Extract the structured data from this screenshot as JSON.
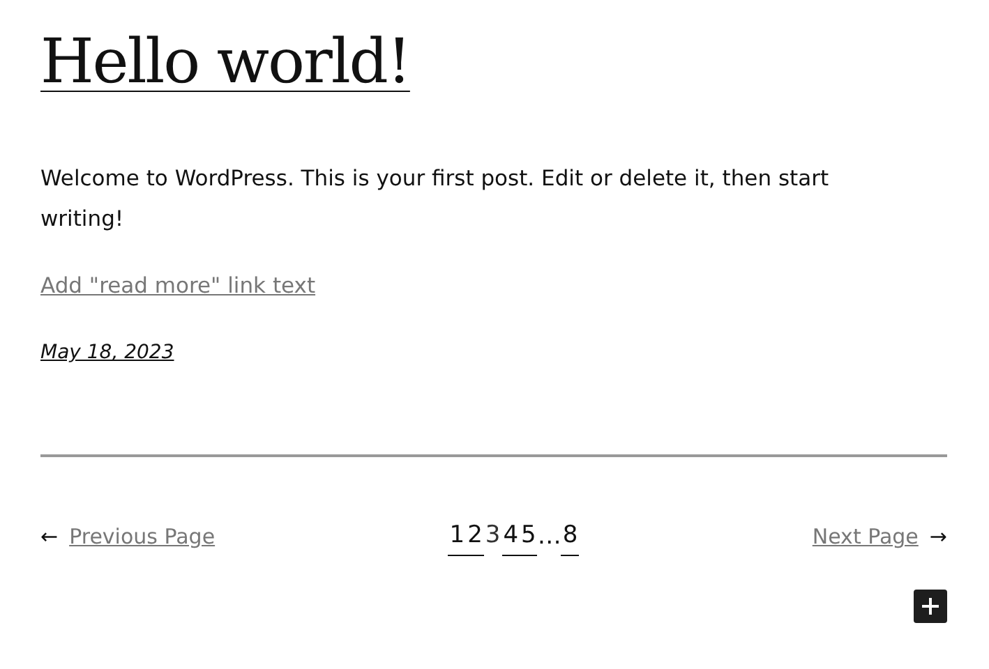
{
  "post": {
    "title": "Hello world!",
    "body": "Welcome to WordPress. This is your first post. Edit or delete it, then start writing!",
    "read_more": "Add \"read more\" link text",
    "date": "May 18, 2023"
  },
  "pagination": {
    "previous": {
      "arrow": "←",
      "label": "Previous Page"
    },
    "pages": [
      {
        "label": "1",
        "selected": false
      },
      {
        "label": "2",
        "selected": false
      },
      {
        "label": "3",
        "selected": true
      },
      {
        "label": "4",
        "selected": false
      },
      {
        "label": "5",
        "selected": false
      },
      {
        "label": "…",
        "kind": "ellipsis"
      },
      {
        "label": "8",
        "selected": false
      }
    ],
    "next": {
      "label": "Next Page",
      "arrow": "→"
    }
  }
}
